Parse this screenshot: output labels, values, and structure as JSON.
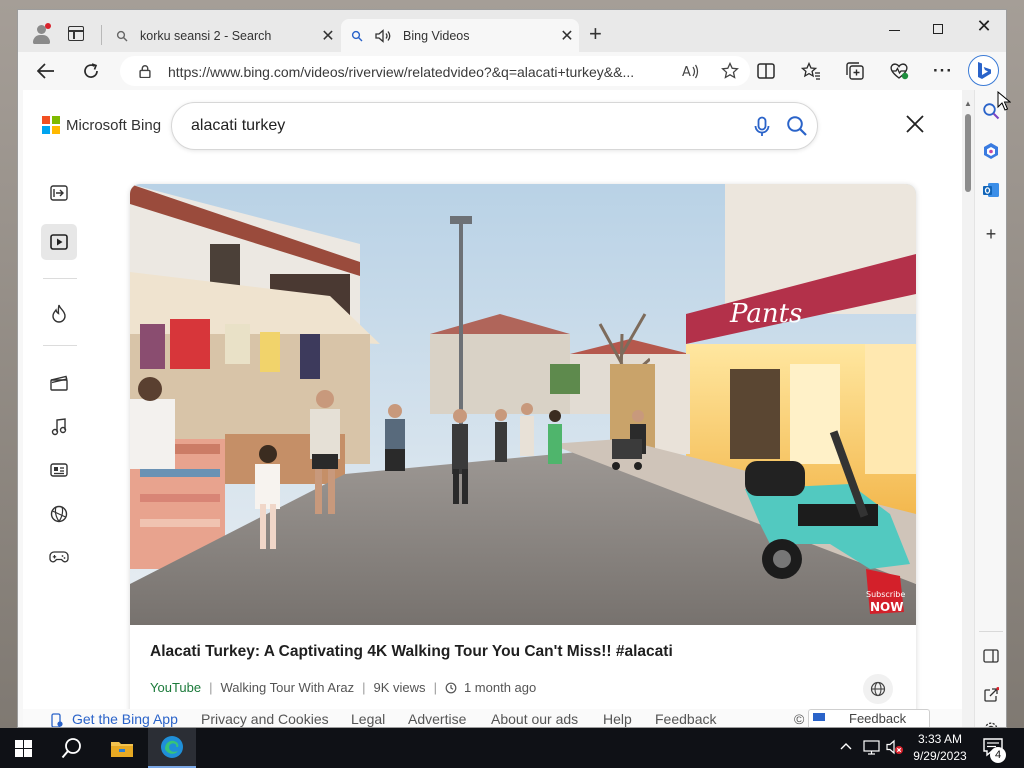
{
  "browser": {
    "tabs": [
      {
        "title": "korku seansi 2 - Search"
      },
      {
        "title": "Bing Videos"
      }
    ],
    "address": "https://www.bing.com/videos/riverview/relatedvideo?&q=alacati+turkey&&..."
  },
  "page": {
    "brand": "Microsoft Bing",
    "query": "alacati turkey",
    "video": {
      "title": "Alacati Turkey: A Captivating 4K Walking Tour You Can't Miss!! #alacati",
      "source": "YouTube",
      "channel": "Walking Tour With Araz",
      "views": "9K views",
      "age": "1 month ago",
      "badge_top": "Subscribe",
      "badge_bottom": "NOW"
    },
    "sign": "Pants",
    "footer": {
      "get_app": "Get the Bing App",
      "privacy": "Privacy and Cookies",
      "legal": "Legal",
      "advertise": "Advertise",
      "about_ads": "About our ads",
      "help": "Help",
      "feedback": "Feedback",
      "copyright": "©",
      "feedback_button": "Feedback"
    }
  },
  "taskbar": {
    "time": "3:33 AM",
    "date": "9/29/2023",
    "notifications": "4"
  },
  "colors": {
    "bing_blue": "#2a63c9",
    "source_green": "#1b7a3a",
    "scooter_teal": "#52c9c0",
    "badge_red": "#d3202a"
  }
}
